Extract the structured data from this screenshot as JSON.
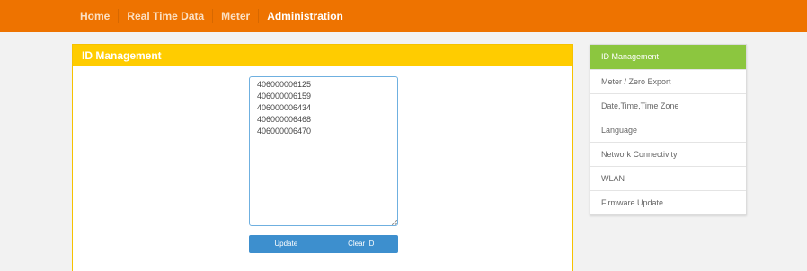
{
  "nav": {
    "items": [
      {
        "label": "Home",
        "active": false
      },
      {
        "label": "Real Time Data",
        "active": false
      },
      {
        "label": "Meter",
        "active": false
      },
      {
        "label": "Administration",
        "active": true
      }
    ]
  },
  "panel": {
    "title": "ID Management",
    "ids_text": "406000006125\n406000006159\n406000006434\n406000006468\n406000006470",
    "update_label": "Update",
    "clear_label": "Clear ID"
  },
  "sidebar": {
    "items": [
      {
        "label": "ID Management",
        "active": true
      },
      {
        "label": "Meter / Zero Export",
        "active": false
      },
      {
        "label": "Date,Time,Time Zone",
        "active": false
      },
      {
        "label": "Language",
        "active": false
      },
      {
        "label": "Network Connectivity",
        "active": false
      },
      {
        "label": "WLAN",
        "active": false
      },
      {
        "label": "Firmware Update",
        "active": false
      }
    ]
  },
  "colors": {
    "topbar": "#ee7300",
    "panel_header": "#ffcc00",
    "button": "#3d8fce",
    "sidebar_active": "#8cc63f"
  }
}
